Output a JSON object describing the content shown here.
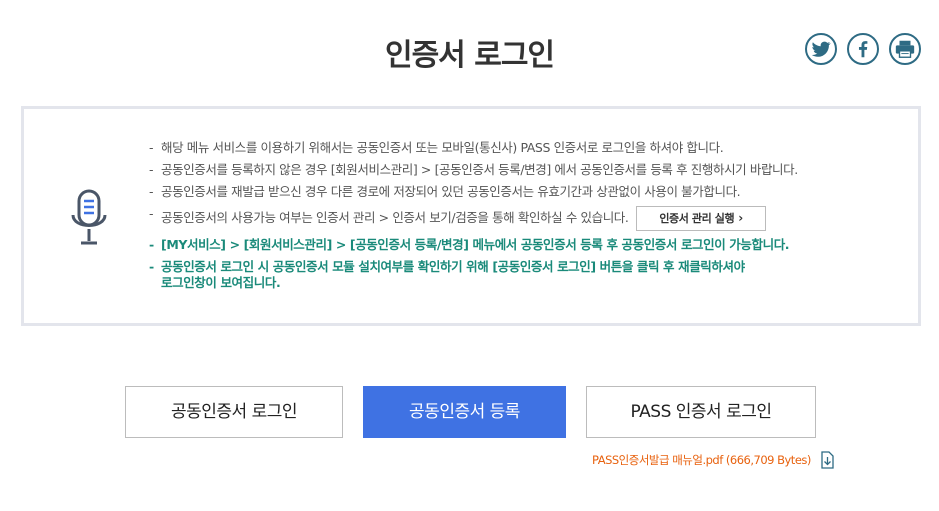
{
  "header": {
    "title": "인증서 로그인",
    "share": [
      {
        "name": "twitter-icon"
      },
      {
        "name": "facebook-icon"
      },
      {
        "name": "print-icon"
      }
    ]
  },
  "notice": {
    "items": [
      "해당 메뉴 서비스를 이용하기 위해서는 공동인증서 또는 모바일(통신사) PASS 인증서로 로그인을 하셔야 합니다.",
      "공동인증서를 등록하지 않은 경우 [회원서비스관리] > [공동인증서 등록/변경] 에서 공동인증서를 등록 후 진행하시기 바랍니다.",
      "공동인증서를 재발급 받으신 경우 다른 경로에 저장되어 있던 공동인증서는 유효기간과 상관없이 사용이 불가합니다.",
      "공동인증서의 사용가능 여부는 인증서 관리 > 인증서 보기/검증을 통해 확인하실 수 있습니다."
    ],
    "cert_manage_button": "인증서 관리 실행",
    "green_items": [
      "[MY서비스] > [회원서비스관리] > [공동인증서 등록/변경] 메뉴에서 공동인증서 등록 후 공동인증서 로그인이 가능합니다.",
      "공동인증서 로그인 시 공동인증서 모듈 설치여부를 확인하기 위해 [공동인증서 로그인] 버튼을 클릭 후 재클릭하셔야",
      "로그인창이 보여집니다."
    ]
  },
  "buttons": {
    "cert_login": "공동인증서 로그인",
    "cert_register": "공동인증서 등록",
    "pass_login": "PASS 인증서 로그인"
  },
  "download": {
    "label": "PASS인증서발급 매뉴얼.pdf (666,709 Bytes)"
  },
  "colors": {
    "primary": "#3f72e3",
    "notice_green": "#1a8a7a",
    "download_orange": "#e8620f",
    "share_border": "#2e6b84"
  }
}
